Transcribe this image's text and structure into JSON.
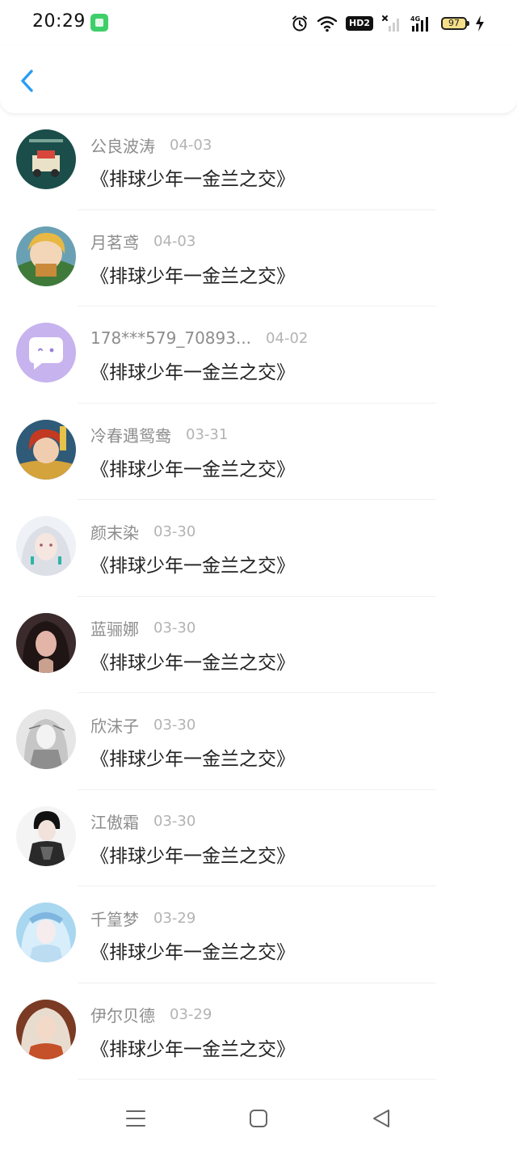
{
  "status_bar": {
    "time": "20:29",
    "network_badge": "HD2",
    "network_type": "4G",
    "battery": "97",
    "icons": [
      "app-notification-icon",
      "alarm-icon",
      "wifi-icon",
      "hd-voice-icon",
      "no-signal-icon",
      "signal-4g-icon",
      "battery-icon",
      "charging-icon"
    ]
  },
  "header": {
    "back_icon": "chevron-left-icon",
    "accent_color": "#2a9df4"
  },
  "items": [
    {
      "name": "公良波涛",
      "date": "04-03",
      "title": "《排球少年一金兰之交》",
      "avatar_color": "#1b4e4a"
    },
    {
      "name": "月茗鸢",
      "date": "04-03",
      "title": "《排球少年一金兰之交》",
      "avatar_color": "#c98a3a"
    },
    {
      "name": "178***579_70893...",
      "date": "04-02",
      "title": "《排球少年一金兰之交》",
      "avatar_color": "#c7b3ee"
    },
    {
      "name": "冷春遇鸳鸯",
      "date": "03-31",
      "title": "《排球少年一金兰之交》",
      "avatar_color": "#b8402a"
    },
    {
      "name": "颜末染",
      "date": "03-30",
      "title": "《排球少年一金兰之交》",
      "avatar_color": "#dfe3ea"
    },
    {
      "name": "蓝骊娜",
      "date": "03-30",
      "title": "《排球少年一金兰之交》",
      "avatar_color": "#6e4a48"
    },
    {
      "name": "欣沫子",
      "date": "03-30",
      "title": "《排球少年一金兰之交》",
      "avatar_color": "#b9b9b9"
    },
    {
      "name": "江傲霜",
      "date": "03-30",
      "title": "《排球少年一金兰之交》",
      "avatar_color": "#2a2a2a"
    },
    {
      "name": "千篁梦",
      "date": "03-29",
      "title": "《排球少年一金兰之交》",
      "avatar_color": "#8cc6e8"
    },
    {
      "name": "伊尔贝德",
      "date": "03-29",
      "title": "《排球少年一金兰之交》",
      "avatar_color": "#a8623e"
    }
  ],
  "nav_bar": {
    "icons": [
      "menu-icon",
      "home-icon",
      "back-triangle-icon"
    ]
  }
}
